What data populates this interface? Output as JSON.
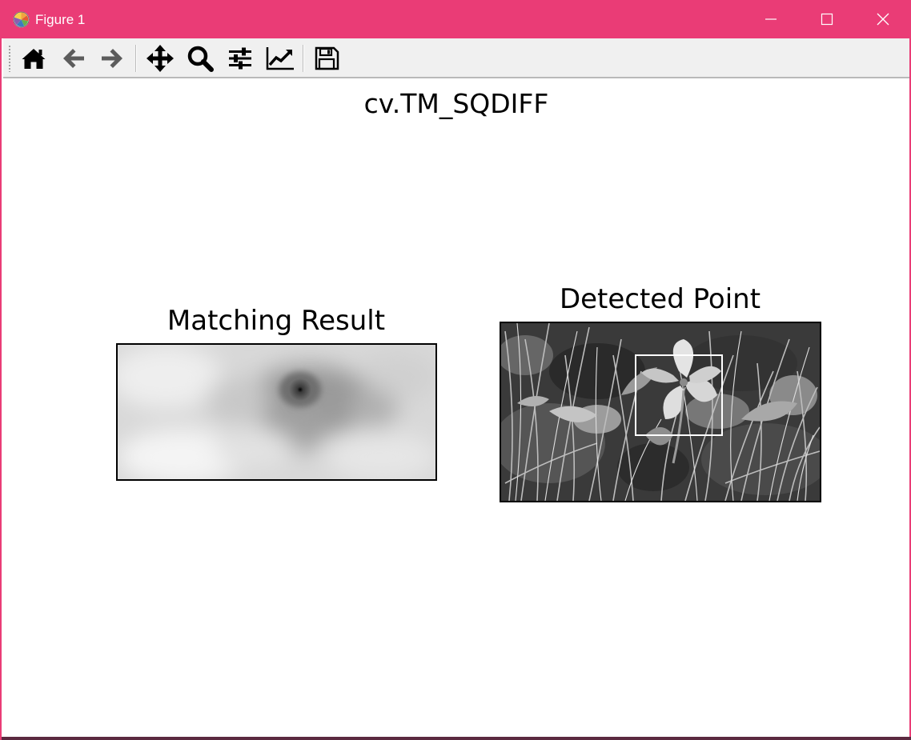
{
  "window": {
    "title": "Figure 1",
    "accent_color": "#ea3c76",
    "controls": {
      "minimize_icon": "minimize-icon",
      "maximize_icon": "maximize-icon",
      "close_icon": "close-icon"
    }
  },
  "toolbar": {
    "buttons": [
      {
        "name": "home-button",
        "icon": "home-icon"
      },
      {
        "name": "back-button",
        "icon": "arrow-left-icon"
      },
      {
        "name": "forward-button",
        "icon": "arrow-right-icon"
      },
      {
        "name": "pan-button",
        "icon": "move-icon"
      },
      {
        "name": "zoom-button",
        "icon": "magnifier-icon"
      },
      {
        "name": "configure-subplots-button",
        "icon": "sliders-icon"
      },
      {
        "name": "edit-axis-button",
        "icon": "line-chart-icon"
      },
      {
        "name": "save-button",
        "icon": "floppy-disk-icon"
      }
    ]
  },
  "figure": {
    "suptitle": "cv.TM_SQDIFF",
    "subplots": [
      {
        "title": "Matching Result",
        "image": "grayscale-heatmap"
      },
      {
        "title": "Detected Point",
        "image": "grayscale-photo-trillium",
        "box_color": "#ffffff"
      }
    ]
  }
}
